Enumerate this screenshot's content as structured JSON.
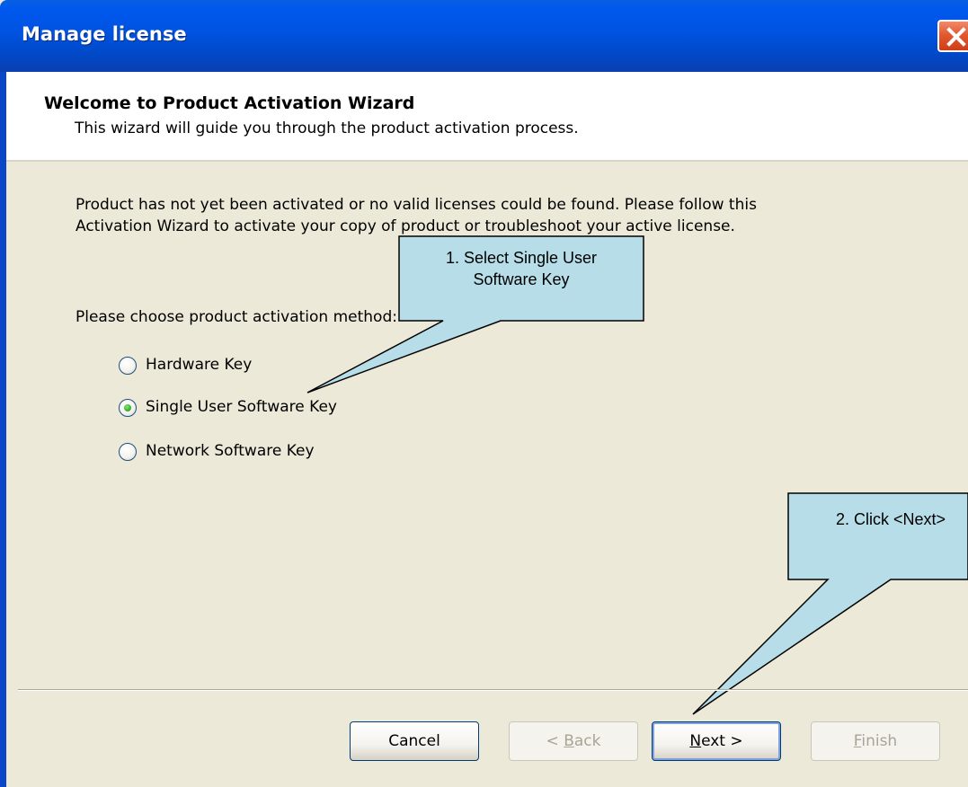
{
  "window": {
    "title": "Manage license"
  },
  "header": {
    "title": "Welcome to Product Activation Wizard",
    "subtitle": "This wizard will guide you through the product activation process."
  },
  "body": {
    "message_line1": "Product has not yet been activated or no valid licenses could be found. Please follow this",
    "message_line2": "Activation Wizard to activate your copy of product or troubleshoot your active license.",
    "method_label": "Please choose product activation method:",
    "options": [
      {
        "label": "Hardware Key",
        "selected": false
      },
      {
        "label": "Single User Software Key",
        "selected": true
      },
      {
        "label": "Network Software Key",
        "selected": false
      }
    ]
  },
  "callouts": {
    "step1_line1": "1. Select Single User",
    "step1_line2": "Software Key",
    "step2": "2. Click <Next>"
  },
  "buttons": {
    "cancel": {
      "label": "Cancel",
      "mnemonic": "",
      "enabled": true
    },
    "back": {
      "label": "< Back",
      "mnemonic": "B",
      "enabled": false
    },
    "next": {
      "label": "Next >",
      "mnemonic": "N",
      "enabled": true
    },
    "finish": {
      "label": "Finish",
      "mnemonic": "F",
      "enabled": false
    }
  },
  "colors": {
    "titlebar": "#0054e3",
    "dialog_bg": "#ece9d8",
    "callout_fill": "#b6dde8",
    "radio_selected": "#37b32a"
  }
}
